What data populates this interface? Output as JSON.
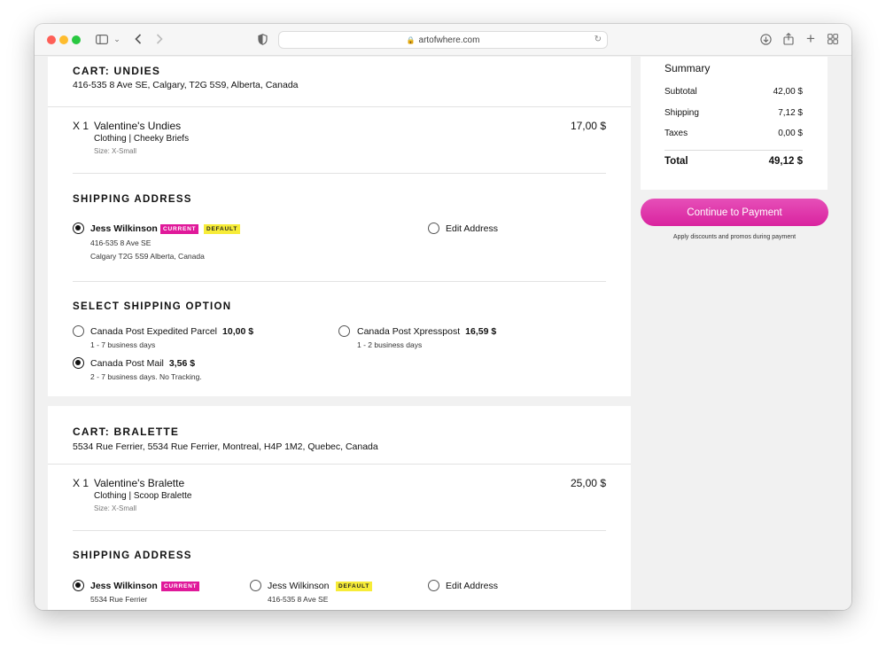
{
  "browser": {
    "url": "artofwhere.com"
  },
  "carts": [
    {
      "title": "CART: UNDIES",
      "address": "416-535 8 Ave SE, Calgary, T2G 5S9, Alberta, Canada",
      "item": {
        "qty": "X 1",
        "name": "Valentine's Undies",
        "category": "Clothing | Cheeky Briefs",
        "size": "Size: X-Small",
        "price": "17,00 $"
      },
      "shipping_address": {
        "title": "SHIPPING ADDRESS",
        "selected_name": "Jess Wilkinson",
        "badge_current": "CURRENT",
        "badge_default": "DEFAULT",
        "line1": "416-535 8 Ave SE",
        "line2": "Calgary T2G 5S9 Alberta, Canada",
        "edit_label": "Edit Address"
      },
      "shipping_option": {
        "title": "SELECT SHIPPING OPTION",
        "options": [
          {
            "name": "Canada Post Expedited Parcel",
            "price": "10,00 $",
            "note": "1 - 7 business days",
            "selected": false
          },
          {
            "name": "Canada Post Xpresspost",
            "price": "16,59 $",
            "note": "1 - 2 business days",
            "selected": false
          },
          {
            "name": "Canada Post Mail",
            "price": "3,56 $",
            "note": "2 - 7 business days. No Tracking.",
            "selected": true
          }
        ]
      }
    },
    {
      "title": "CART: BRALETTE",
      "address": "5534 Rue Ferrier, 5534 Rue Ferrier, Montreal, H4P 1M2, Quebec, Canada",
      "item": {
        "qty": "X 1",
        "name": "Valentine's Bralette",
        "category": "Clothing | Scoop Bralette",
        "size": "Size: X-Small",
        "price": "25,00 $"
      },
      "shipping_address": {
        "title": "SHIPPING ADDRESS",
        "addr1_name": "Jess Wilkinson",
        "addr1_badge": "CURRENT",
        "addr1_line1": "5534 Rue Ferrier",
        "addr2_name": "Jess Wilkinson",
        "addr2_badge": "DEFAULT",
        "addr2_line1": "416-535 8 Ave SE",
        "edit_label": "Edit Address"
      }
    }
  ],
  "summary": {
    "title": "Summary",
    "rows": [
      {
        "label": "Subtotal",
        "value": "42,00 $"
      },
      {
        "label": "Shipping",
        "value": "7,12 $"
      },
      {
        "label": "Taxes",
        "value": "0,00 $"
      }
    ],
    "total_label": "Total",
    "total_value": "49,12 $",
    "pay_button": "Continue to Payment",
    "pay_note": "Apply discounts and promos during payment"
  },
  "colors": {
    "accent": "#e0199a",
    "badge_default": "#f7ec38"
  }
}
